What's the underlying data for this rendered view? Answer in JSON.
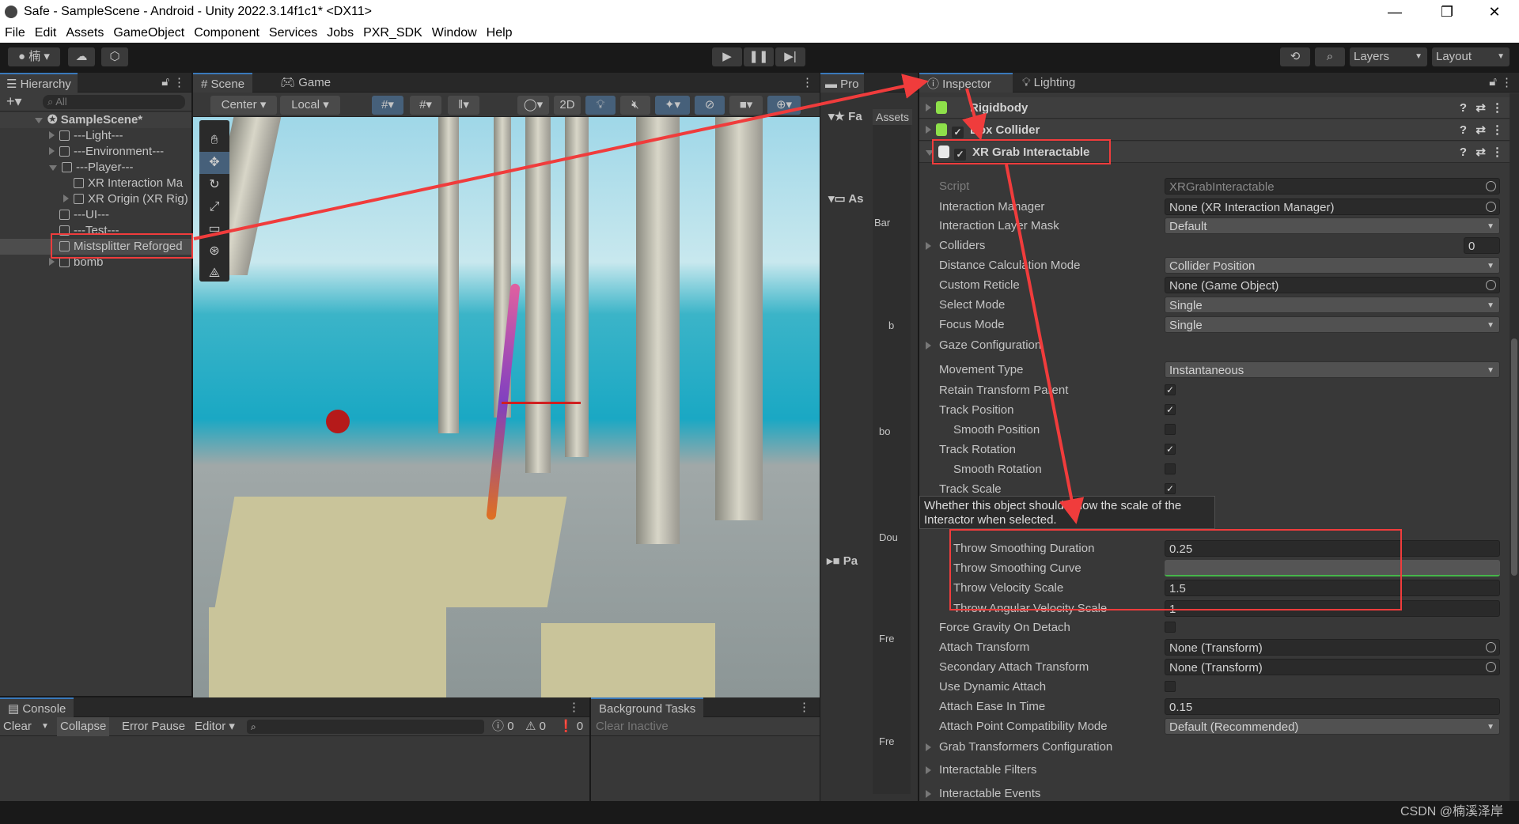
{
  "window": {
    "title": "Safe - SampleScene - Android - Unity 2022.3.14f1c1* <DX11>",
    "minimize": "—",
    "maximize": "❐",
    "close": "✕"
  },
  "menu": [
    "File",
    "Edit",
    "Assets",
    "GameObject",
    "Component",
    "Services",
    "Jobs",
    "PXR_SDK",
    "Window",
    "Help"
  ],
  "toolbar": {
    "account": "楠",
    "layers": "Layers",
    "layout": "Layout"
  },
  "hierarchy": {
    "tab": "Hierarchy",
    "search_placeholder": "All",
    "scene": "SampleScene*",
    "items": [
      {
        "label": "---Light---",
        "depth": 1,
        "expander": "right"
      },
      {
        "label": "---Environment---",
        "depth": 1,
        "expander": "right"
      },
      {
        "label": "---Player---",
        "depth": 1,
        "expander": "down"
      },
      {
        "label": "XR Interaction Ma",
        "depth": 2,
        "expander": "none"
      },
      {
        "label": "XR Origin (XR Rig)",
        "depth": 2,
        "expander": "right"
      },
      {
        "label": "---UI---",
        "depth": 1,
        "expander": "none"
      },
      {
        "label": "---Test---",
        "depth": 1,
        "expander": "none"
      },
      {
        "label": "Mistsplitter Reforged",
        "depth": 1,
        "expander": "none",
        "selected": true
      },
      {
        "label": "bomb",
        "depth": 1,
        "expander": "right"
      }
    ]
  },
  "scene": {
    "tabs": [
      "Scene",
      "Game"
    ],
    "pivot": "Center",
    "space": "Local",
    "mode_2d": "2D"
  },
  "project": {
    "tab": "Pro",
    "favorites": "Fa",
    "assets_header": "Assets",
    "assets_tree": "As",
    "packages": "Pa",
    "items": [
      "Bar",
      "b",
      "bo",
      "Dou",
      "Fre",
      "Fre"
    ]
  },
  "inspector": {
    "tabs": [
      "Inspector",
      "Lighting"
    ],
    "components": [
      {
        "name": "Rigidbody",
        "enabled": null,
        "icon_color": "#8ee04a"
      },
      {
        "name": "Box Collider",
        "enabled": true,
        "icon_color": "#8ee04a"
      },
      {
        "name": "XR Grab Interactable",
        "enabled": true,
        "icon_color": "#e8e8e8"
      }
    ],
    "properties": [
      {
        "label": "Script",
        "type": "obj",
        "value": "XRGrabInteractable",
        "dim": true
      },
      {
        "label": "Interaction Manager",
        "type": "obj",
        "value": "None (XR Interaction Manager)"
      },
      {
        "label": "Interaction Layer Mask",
        "type": "drop",
        "value": "Default"
      },
      {
        "label": "Colliders",
        "type": "small",
        "value": "0",
        "foldout": true
      },
      {
        "label": "Distance Calculation Mode",
        "type": "drop",
        "value": "Collider Position"
      },
      {
        "label": "Custom Reticle",
        "type": "obj",
        "value": "None (Game Object)"
      },
      {
        "label": "Select Mode",
        "type": "drop",
        "value": "Single"
      },
      {
        "label": "Focus Mode",
        "type": "drop",
        "value": "Single"
      },
      {
        "label": "Gaze Configuration",
        "type": "none",
        "foldout": true
      },
      {
        "label": "Movement Type",
        "type": "drop",
        "value": "Instantaneous"
      },
      {
        "label": "Retain Transform Parent",
        "type": "check",
        "checked": true
      },
      {
        "label": "Track Position",
        "type": "check",
        "checked": true
      },
      {
        "label": "Smooth Position",
        "type": "check",
        "checked": false,
        "indent": true
      },
      {
        "label": "Track Rotation",
        "type": "check",
        "checked": true
      },
      {
        "label": "Smooth Rotation",
        "type": "check",
        "checked": false,
        "indent": true
      },
      {
        "label": "Track Scale",
        "type": "check",
        "checked": true
      },
      {
        "label": "Throw Smoothing Duration",
        "type": "field",
        "value": "0.25",
        "indent": true
      },
      {
        "label": "Throw Smoothing Curve",
        "type": "curve",
        "indent": true
      },
      {
        "label": "Throw Velocity Scale",
        "type": "field",
        "value": "1.5",
        "indent": true
      },
      {
        "label": "Throw Angular Velocity Scale",
        "type": "field",
        "value": "1",
        "indent": true
      },
      {
        "label": "Force Gravity On Detach",
        "type": "check",
        "checked": false
      },
      {
        "label": "Attach Transform",
        "type": "obj",
        "value": "None (Transform)"
      },
      {
        "label": "Secondary Attach Transform",
        "type": "obj",
        "value": "None (Transform)"
      },
      {
        "label": "Use Dynamic Attach",
        "type": "check",
        "checked": false
      },
      {
        "label": "Attach Ease In Time",
        "type": "field",
        "value": "0.15"
      },
      {
        "label": "Attach Point Compatibility Mode",
        "type": "drop",
        "value": "Default (Recommended)"
      },
      {
        "label": "Grab Transformers Configuration",
        "type": "none",
        "foldout": true
      },
      {
        "label": "Interactable Filters",
        "type": "none",
        "foldout": true
      },
      {
        "label": "Interactable Events",
        "type": "none",
        "foldout": true
      }
    ],
    "tooltip": "Whether this object should follow the scale of the Interactor when selected."
  },
  "console": {
    "tab": "Console",
    "clear": "Clear",
    "collapse": "Collapse",
    "error_pause": "Error Pause",
    "editor": "Editor",
    "log_count": "0",
    "warn_count": "0",
    "error_count": "0"
  },
  "background_tasks": {
    "tab": "Background Tasks",
    "clear_inactive": "Clear Inactive"
  },
  "watermark": "CSDN @楠溪泽岸",
  "colors": {
    "annotation": "#f03c3c",
    "selection": "#2c5d87",
    "accent_tab": "#3a79bb"
  }
}
